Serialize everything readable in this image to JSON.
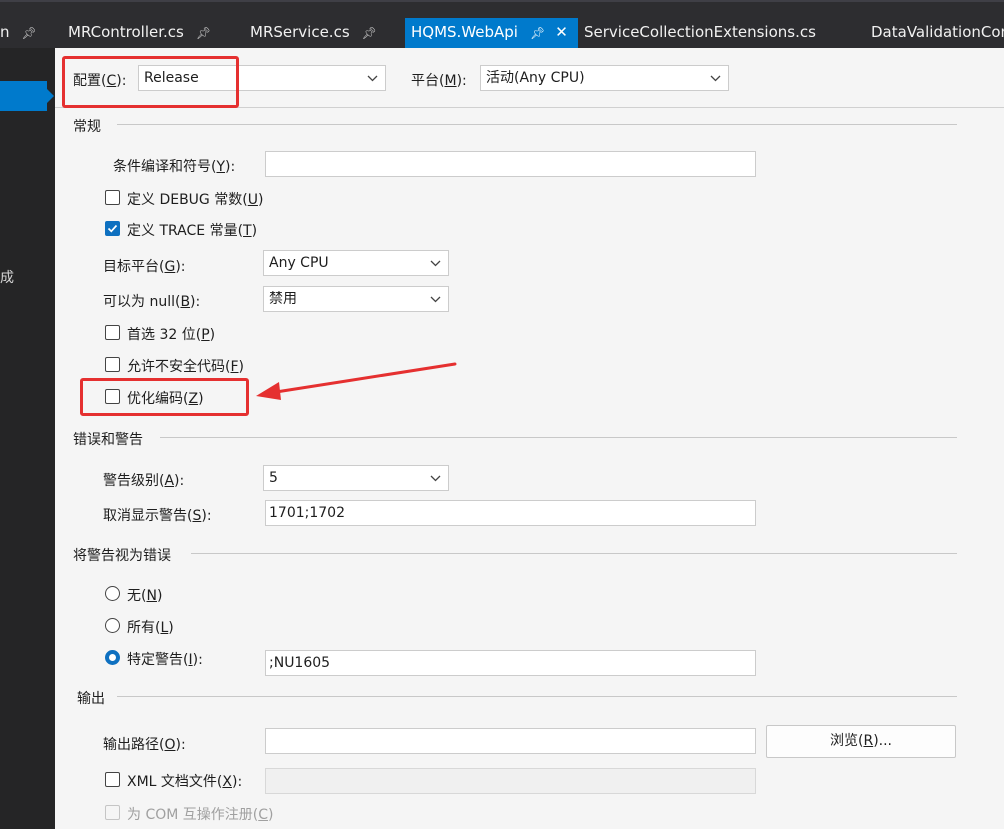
{
  "tabs": [
    {
      "label": "n",
      "pinned": true
    },
    {
      "label": "MRController.cs",
      "pinned": true
    },
    {
      "label": "MRService.cs",
      "pinned": true
    },
    {
      "label": "HQMS.WebApi",
      "pinned": true,
      "active": true
    },
    {
      "label": "ServiceCollectionExtensions.cs"
    },
    {
      "label": "DataValidationCon"
    }
  ],
  "leftnav": {
    "fragment": "成"
  },
  "config": {
    "label": "配置(",
    "mnemonic": "C",
    "suffix": "):",
    "value": "Release"
  },
  "platform": {
    "label": "平台(",
    "mnemonic": "M",
    "suffix": "):",
    "value": "活动(Any CPU)"
  },
  "groups": {
    "general": "常规",
    "errors": "错误和警告",
    "treat_warnings": "将警告视为错误",
    "output": "输出"
  },
  "general": {
    "conditional_symbols": {
      "label": "条件编译和符号(",
      "mnemonic": "Y",
      "suffix": "):",
      "value": ""
    },
    "define_debug": {
      "label": "定义 DEBUG 常数(",
      "mnemonic": "U",
      "suffix": ")",
      "checked": false
    },
    "define_trace": {
      "label": "定义 TRACE 常量(",
      "mnemonic": "T",
      "suffix": ")",
      "checked": true
    },
    "target_platform": {
      "label": "目标平台(",
      "mnemonic": "G",
      "suffix": "):",
      "value": "Any CPU"
    },
    "nullable": {
      "label": "可以为 null(",
      "mnemonic": "B",
      "suffix": "):",
      "value": "禁用"
    },
    "prefer32": {
      "label": "首选 32 位(",
      "mnemonic": "P",
      "suffix": ")",
      "checked": false
    },
    "unsafe": {
      "label": "允许不安全代码(",
      "mnemonic": "F",
      "suffix": ")",
      "checked": false
    },
    "optimize": {
      "label": "优化编码(",
      "mnemonic": "Z",
      "suffix": ")",
      "checked": false
    }
  },
  "errors": {
    "warning_level": {
      "label": "警告级别(",
      "mnemonic": "A",
      "suffix": "):",
      "value": "5"
    },
    "suppress": {
      "label": "取消显示警告(",
      "mnemonic": "S",
      "suffix": "):",
      "value": "1701;1702"
    }
  },
  "treat": {
    "none": {
      "label": "无(",
      "mnemonic": "N",
      "suffix": ")",
      "selected": false
    },
    "all": {
      "label": "所有(",
      "mnemonic": "L",
      "suffix": ")",
      "selected": false
    },
    "specific": {
      "label": "特定警告(",
      "mnemonic": "I",
      "suffix": "):",
      "selected": true,
      "value": ";NU1605"
    }
  },
  "output": {
    "path": {
      "label": "输出路径(",
      "mnemonic": "O",
      "suffix": "):",
      "value": ""
    },
    "browse": {
      "label": "浏览(",
      "mnemonic": "R",
      "suffix": ")..."
    },
    "xml": {
      "label": "XML 文档文件(",
      "mnemonic": "X",
      "suffix": "):",
      "checked": false,
      "value": ""
    },
    "com": {
      "label": "为 COM 互操作注册(",
      "mnemonic": "C",
      "suffix": ")",
      "checked": false
    }
  },
  "colors": {
    "accent": "#007acc",
    "annotation": "#e53030",
    "panel": "#f5f5f5",
    "chrome": "#2d2d30"
  }
}
